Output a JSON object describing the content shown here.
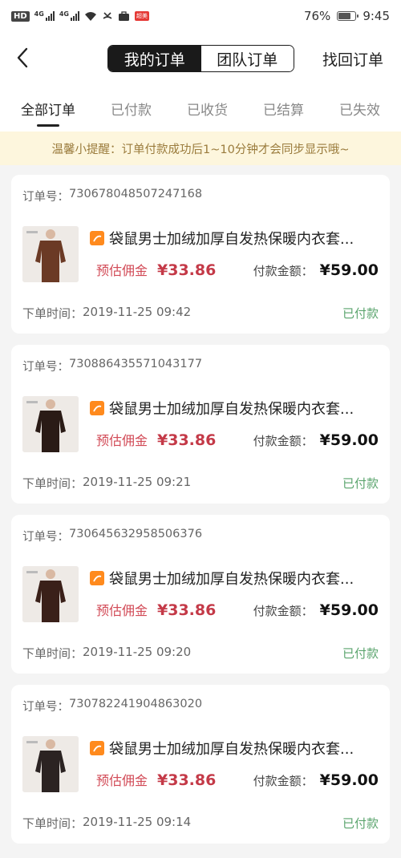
{
  "status_bar": {
    "hd": "HD",
    "net1": "4G",
    "net2": "4G",
    "battery": "76%",
    "battery_level": 0.76,
    "time": "9:45",
    "app_badge": "超美"
  },
  "header": {
    "tabs": [
      "我的订单",
      "团队订单"
    ],
    "active_tab": 0,
    "retrieve_label": "找回订单"
  },
  "filters": {
    "items": [
      "全部订单",
      "已付款",
      "已收货",
      "已结算",
      "已失效"
    ],
    "active": 0
  },
  "notice": "温馨小提醒：订单付款成功后1~10分钟才会同步显示哦~",
  "labels": {
    "order_no": "订单号：",
    "order_time": "下单时间：",
    "commission": "预估佣金",
    "paid": "付款金额："
  },
  "orders": [
    {
      "order_no": "730678048507247168",
      "title": "袋鼠男士加绒加厚自发热保暖内衣套...",
      "commission": "¥33.86",
      "paid": "¥59.00",
      "time": "2019-11-25 09:42",
      "status": "已付款",
      "thumb_color": "#6b3a25"
    },
    {
      "order_no": "730886435571043177",
      "title": "袋鼠男士加绒加厚自发热保暖内衣套...",
      "commission": "¥33.86",
      "paid": "¥59.00",
      "time": "2019-11-25 09:21",
      "status": "已付款",
      "thumb_color": "#2a1b16"
    },
    {
      "order_no": "730645632958506376",
      "title": "袋鼠男士加绒加厚自发热保暖内衣套...",
      "commission": "¥33.86",
      "paid": "¥59.00",
      "time": "2019-11-25 09:20",
      "status": "已付款",
      "thumb_color": "#3a2019"
    },
    {
      "order_no": "730782241904863020",
      "title": "袋鼠男士加绒加厚自发热保暖内衣套...",
      "commission": "¥33.86",
      "paid": "¥59.00",
      "time": "2019-11-25 09:14",
      "status": "已付款",
      "thumb_color": "#2b2322"
    }
  ],
  "colors": {
    "accent_price": "#c43a48",
    "status_green": "#5aa46d",
    "notice_bg": "#fdf6dd",
    "notice_text": "#9a7b3c"
  }
}
